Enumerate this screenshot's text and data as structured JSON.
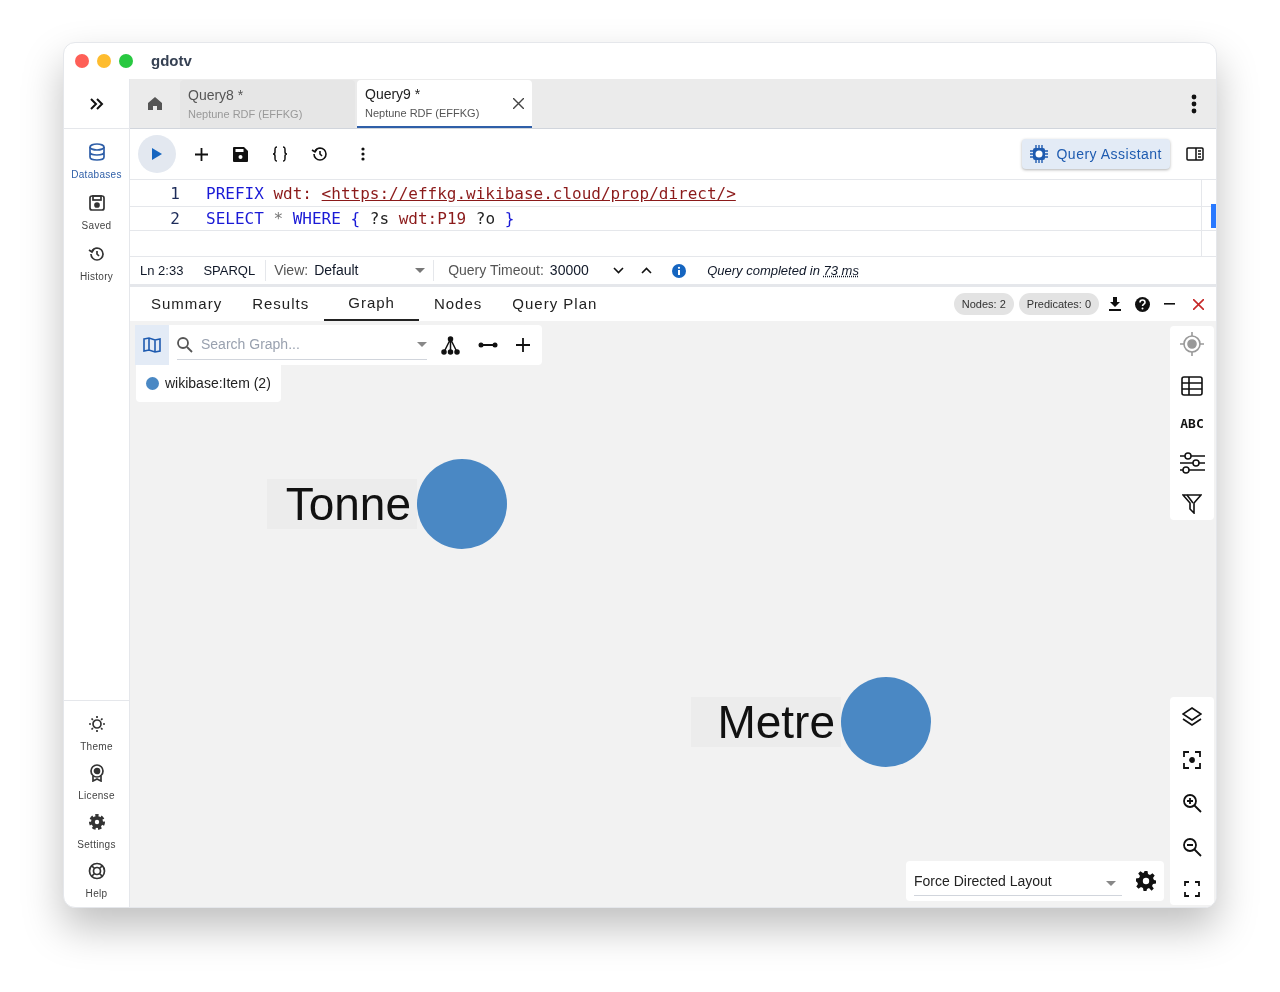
{
  "window": {
    "title": "gdotv"
  },
  "sidebar": {
    "items": [
      {
        "label": "Databases",
        "kind": "database",
        "selected": true
      },
      {
        "label": "Saved",
        "kind": "save",
        "selected": false
      },
      {
        "label": "History",
        "kind": "history",
        "selected": false
      }
    ],
    "bottom_items": [
      {
        "label": "Theme",
        "kind": "theme"
      },
      {
        "label": "License",
        "kind": "license"
      },
      {
        "label": "Settings",
        "kind": "settings"
      },
      {
        "label": "Help",
        "kind": "help"
      }
    ]
  },
  "tabs": [
    {
      "title": "Query8 *",
      "subtitle": "Neptune RDF (EFFKG)",
      "selected": false
    },
    {
      "title": "Query9 *",
      "subtitle": "Neptune RDF (EFFKG)",
      "selected": true
    }
  ],
  "toolbar": {
    "assistant_button": "Query Assistant"
  },
  "editor": {
    "lines": [
      {
        "number": "1",
        "tokens": [
          {
            "kind": "keyword",
            "text": "PREFIX"
          },
          {
            "kind": "prefix",
            "text": "wdt:"
          },
          {
            "kind": "iri",
            "text": "<https://effkg.wikibase.cloud/prop/direct/>"
          }
        ]
      },
      {
        "number": "2",
        "tokens": [
          {
            "kind": "keyword",
            "text": "SELECT"
          },
          {
            "kind": "operator",
            "text": "*"
          },
          {
            "kind": "keyword",
            "text": "WHERE"
          },
          {
            "kind": "keyword",
            "text": "{"
          },
          {
            "kind": "variable",
            "text": "?s"
          },
          {
            "kind": "prefix",
            "text": "wdt:P19"
          },
          {
            "kind": "variable",
            "text": "?o"
          },
          {
            "kind": "keyword",
            "text": "}"
          }
        ]
      }
    ]
  },
  "status_bar": {
    "position": "Ln 2:33",
    "language": "SPARQL",
    "view_label": "View:",
    "view_value": "Default",
    "timeout_label": "Query Timeout:",
    "timeout_value": "30000",
    "message": "Query completed in",
    "duration": "73 ms"
  },
  "result_tabs": [
    {
      "label": "Summary",
      "selected": false
    },
    {
      "label": "Results",
      "selected": false
    },
    {
      "label": "Graph",
      "selected": true
    },
    {
      "label": "Nodes",
      "selected": false
    },
    {
      "label": "Query Plan",
      "selected": false
    }
  ],
  "counts": [
    "Nodes: 2",
    "Predicates: 0"
  ],
  "graph": {
    "search_placeholder": "Search Graph...",
    "labels_toggle": "ABC",
    "legend": [
      {
        "label": "wikibase:Item (2)",
        "color": "#4a88c4"
      }
    ],
    "nodes": [
      {
        "label": "Tonne",
        "color": "#4a88c4"
      },
      {
        "label": "Metre",
        "color": "#4a88c4"
      }
    ],
    "layout": "Force Directed Layout"
  }
}
